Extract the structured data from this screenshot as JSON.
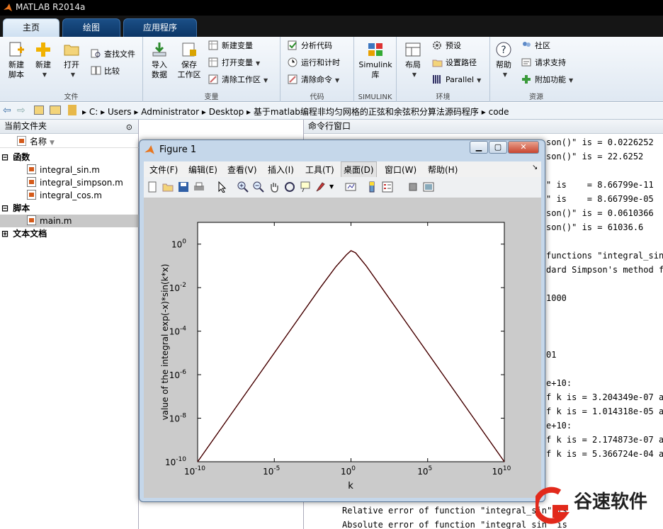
{
  "app": {
    "title": "MATLAB R2014a"
  },
  "tabs": [
    {
      "label": "主页"
    },
    {
      "label": "绘图"
    },
    {
      "label": "应用程序"
    }
  ],
  "ribbon": {
    "file_group": {
      "label": "文件",
      "new_script": "新建\n脚本",
      "new": "新建",
      "open": "打开",
      "find_files": "查找文件",
      "compare": "比较"
    },
    "variable_group": {
      "label": "变量",
      "import": "导入\n数据",
      "save_ws": "保存\n工作区",
      "new_var": "新建变量",
      "open_var": "打开变量",
      "clear_ws": "清除工作区"
    },
    "code_group": {
      "label": "代码",
      "analyze": "分析代码",
      "run_time": "运行和计时",
      "clear_cmd": "清除命令"
    },
    "simulink_group": {
      "label": "SIMULINK",
      "simulink": "Simulink\n库"
    },
    "env_group": {
      "label": "环境",
      "layout": "布局",
      "prefs": "预设",
      "set_path": "设置路径",
      "parallel": "Parallel"
    },
    "res_group": {
      "label": "资源",
      "help": "帮助",
      "community": "社区",
      "request_support": "请求支持",
      "addons": "附加功能"
    }
  },
  "path": {
    "crumbs": [
      "C:",
      "Users",
      "Administrator",
      "Desktop",
      "基于matlab编程非均匀网格的正弦和余弦积分算法源码程序",
      "code"
    ]
  },
  "left_panel": {
    "title": "当前文件夹",
    "col_header": "名称",
    "sections": [
      {
        "label": "函数",
        "files": [
          "integral_sin.m",
          "integral_simpson.m",
          "integral_cos.m"
        ]
      },
      {
        "label": "脚本",
        "files": [
          "main.m"
        ]
      },
      {
        "label": "文本文档",
        "files": []
      }
    ]
  },
  "cmd_panel": {
    "title": "命令行窗口",
    "lines": [
      "son()\" is = 0.0226252",
      "son()\" is = 22.6252",
      "\" is    = 8.66799e-11",
      "\" is    = 8.66799e-05",
      "son()\" is = 0.0610366",
      "son()\" is = 61036.6",
      "functions \"integral_sin(",
      "dard Simpson's method fu",
      "1000",
      "01",
      "e+10:",
      "f k is = 3.204349e-07 an",
      "f k is = 1.014318e-05 an",
      "e+10:",
      "f k is = 2.174873e-07 an",
      "f k is = 5.366724e-04 an",
      "Relative error of function \"integral_sin\" is",
      "Absolute error of function \"integral_sin\" is"
    ]
  },
  "figure": {
    "title": "Figure 1",
    "menu": [
      "文件(F)",
      "编辑(E)",
      "查看(V)",
      "插入(I)",
      "工具(T)",
      "桌面(D)",
      "窗口(W)",
      "帮助(H)"
    ]
  },
  "chart_data": {
    "type": "line",
    "title": "",
    "xlabel": "k",
    "ylabel": "value of the integral exp(-x)*sin(k*x)",
    "xscale": "log",
    "yscale": "log",
    "xlim": [
      1e-10,
      10000000000.0
    ],
    "ylim": [
      1e-10,
      10
    ],
    "xticks": [
      "10",
      "10",
      "10",
      "10",
      "10"
    ],
    "xtick_exps": [
      "-10",
      "-5",
      "0",
      "5",
      "10"
    ],
    "yticks": [
      "10",
      "10",
      "10",
      "10",
      "10",
      "10"
    ],
    "ytick_exps": [
      "0",
      "-2",
      "-4",
      "-6",
      "-8",
      "-10"
    ],
    "series": [
      {
        "color": "#cc0000",
        "x": [
          1e-10,
          1e-08,
          1e-06,
          0.0001,
          0.01,
          0.1,
          0.5,
          1,
          2,
          10,
          100,
          10000.0,
          1000000.0,
          100000000.0,
          10000000000.0
        ],
        "y": [
          1e-10,
          1e-08,
          1e-06,
          0.0001,
          0.01,
          0.09,
          0.32,
          0.5,
          0.4,
          0.099,
          0.01,
          0.0001,
          1e-06,
          1e-08,
          1e-10
        ]
      },
      {
        "color": "#000000",
        "x": [
          1e-10,
          1e-08,
          1e-06,
          0.0001,
          0.01,
          0.1,
          0.5,
          1,
          2,
          10,
          100,
          10000.0,
          1000000.0,
          100000000.0,
          10000000000.0
        ],
        "y": [
          1e-10,
          1e-08,
          1e-06,
          0.0001,
          0.01,
          0.09,
          0.32,
          0.5,
          0.4,
          0.099,
          0.01,
          0.0001,
          1e-06,
          1e-08,
          1e-10
        ]
      }
    ]
  },
  "watermark": {
    "text": "谷速软件",
    "url": "www.gususoft.com"
  }
}
